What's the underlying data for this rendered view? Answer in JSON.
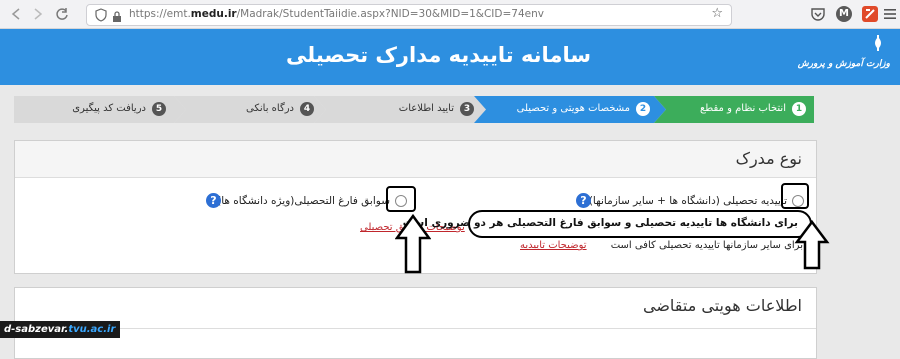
{
  "browser": {
    "url_prefix": "https://emt.",
    "url_domain": "medu.ir",
    "url_rest": "/Madrak/StudentTaiidie.aspx?NID=30&MID=1&CID=74env",
    "account_initial": "M",
    "icons": [
      "shield-icon",
      "lock-icon",
      "star-icon",
      "pocket-icon",
      "account-icon",
      "extension-icon",
      "menu-icon"
    ]
  },
  "header": {
    "title": "سامانه تاییدیه مدارک تحصیلی",
    "logo_text": "وزارت آموزش و پرورش"
  },
  "steps": [
    {
      "num": "1",
      "label": "انتخاب نظام و مقطع",
      "state": "done"
    },
    {
      "num": "2",
      "label": "مشخصات هویتی و تحصیلی",
      "state": "active"
    },
    {
      "num": "3",
      "label": "تایید اطلاعات",
      "state": "pending"
    },
    {
      "num": "4",
      "label": "درگاه بانکی",
      "state": "pending"
    },
    {
      "num": "5",
      "label": "دریافت کد پیگیری",
      "state": "pending"
    }
  ],
  "colors": {
    "done": "#3cad5b",
    "active": "#2d8fe0",
    "pending": "#d9d9d9"
  },
  "document_type": {
    "title": "نوع مدرک",
    "option1": "تاییدیه تحصیلی (دانشگاه ها + سایر سازمانها)",
    "option2": "سوابق فارغ التحصیلی(ویژه دانشگاه ها)",
    "help": "?",
    "link1": "توضیحات تاییدیه",
    "link2": "توضیحات سوابق تحصیلی",
    "note": "برای سایر سازمانها تاییدیه تحصیلی کافی است",
    "callout": "برای دانشگاه ها تاییدیه تحصیلی و سوابق فارغ التحصیلی هر دو ضروری است"
  },
  "identity": {
    "title": "اطلاعات هویتی متقاضی"
  },
  "watermark": {
    "prefix": "d-sabzevar.",
    "suffix": "tvu.ac.ir"
  }
}
